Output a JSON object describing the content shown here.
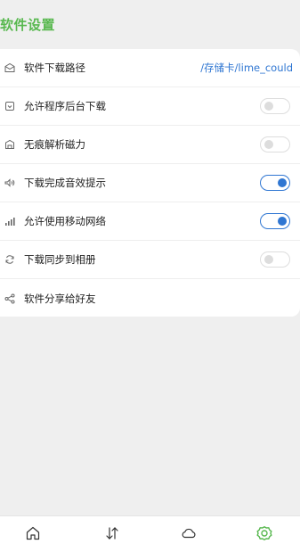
{
  "header": {
    "title": "软件设置"
  },
  "settings": [
    {
      "icon": "folder-icon",
      "label": "软件下载路径",
      "value": "/存储卡/lime_could"
    },
    {
      "icon": "background-download-icon",
      "label": "允许程序后台下载",
      "toggle": "off"
    },
    {
      "icon": "magnet-icon",
      "label": "无痕解析磁力",
      "toggle": "off"
    },
    {
      "icon": "sound-icon",
      "label": "下载完成音效提示",
      "toggle": "on"
    },
    {
      "icon": "signal-icon",
      "label": "允许使用移动网络",
      "toggle": "on"
    },
    {
      "icon": "sync-icon",
      "label": "下载同步到相册",
      "toggle": "off"
    },
    {
      "icon": "share-icon",
      "label": "软件分享给好友"
    }
  ],
  "tabbar": {
    "tabs": [
      {
        "icon": "home-icon",
        "active": false
      },
      {
        "icon": "transfer-icon",
        "active": false
      },
      {
        "icon": "cloud-icon",
        "active": false
      },
      {
        "icon": "settings-gear-icon",
        "active": true
      }
    ]
  },
  "colors": {
    "accent_green": "#58b84f",
    "accent_blue": "#2f76d2",
    "background": "#efefef"
  }
}
